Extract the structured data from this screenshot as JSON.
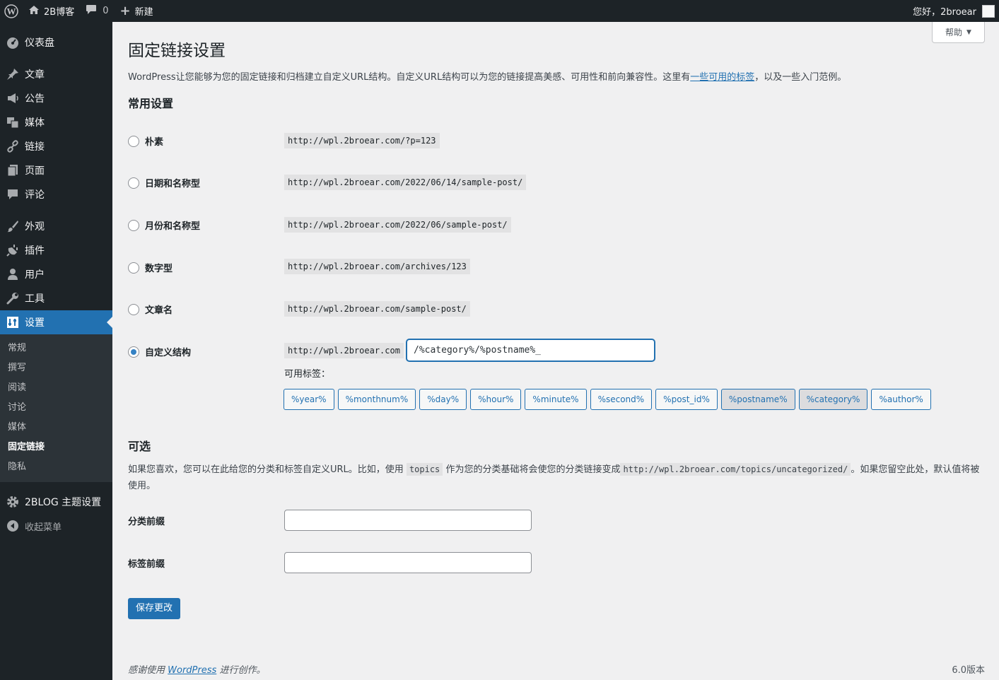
{
  "admin_bar": {
    "site_name": "2B博客",
    "comments_count": "0",
    "new_label": "新建",
    "greeting": "您好，2broear"
  },
  "sidebar": {
    "items": [
      {
        "label": "仪表盘",
        "icon": "dashboard-icon"
      },
      {
        "label": "文章",
        "icon": "pin-icon"
      },
      {
        "label": "公告",
        "icon": "megaphone-icon"
      },
      {
        "label": "媒体",
        "icon": "media-icon"
      },
      {
        "label": "链接",
        "icon": "link-icon"
      },
      {
        "label": "页面",
        "icon": "page-icon"
      },
      {
        "label": "评论",
        "icon": "comment-icon"
      },
      {
        "label": "外观",
        "icon": "brush-icon"
      },
      {
        "label": "插件",
        "icon": "plugin-icon"
      },
      {
        "label": "用户",
        "icon": "user-icon"
      },
      {
        "label": "工具",
        "icon": "wrench-icon"
      },
      {
        "label": "设置",
        "icon": "settings-icon"
      }
    ],
    "submenu": [
      "常规",
      "撰写",
      "阅读",
      "讨论",
      "媒体",
      "固定链接",
      "隐私"
    ],
    "theme_settings": "2BLOG 主题设置",
    "collapse": "收起菜单"
  },
  "help_tab": "帮助",
  "page": {
    "title": "固定链接设置",
    "intro_before": "WordPress让您能够为您的固定链接和归档建立自定义URL结构。自定义URL结构可以为您的链接提高美感、可用性和前向兼容性。这里有",
    "intro_link": "一些可用的标签",
    "intro_after": "，以及一些入门范例。"
  },
  "common_settings": {
    "heading": "常用设置",
    "options": [
      {
        "label": "朴素",
        "example": "http://wpl.2broear.com/?p=123",
        "checked": false
      },
      {
        "label": "日期和名称型",
        "example": "http://wpl.2broear.com/2022/06/14/sample-post/",
        "checked": false
      },
      {
        "label": "月份和名称型",
        "example": "http://wpl.2broear.com/2022/06/sample-post/",
        "checked": false
      },
      {
        "label": "数字型",
        "example": "http://wpl.2broear.com/archives/123",
        "checked": false
      },
      {
        "label": "文章名",
        "example": "http://wpl.2broear.com/sample-post/",
        "checked": false
      },
      {
        "label": "自定义结构",
        "example": "http://wpl.2broear.com",
        "checked": true
      }
    ],
    "custom_value": "/%category%/%postname%_",
    "available_tags_label": "可用标签：",
    "tags": [
      {
        "label": "%year%",
        "pressed": false
      },
      {
        "label": "%monthnum%",
        "pressed": false
      },
      {
        "label": "%day%",
        "pressed": false
      },
      {
        "label": "%hour%",
        "pressed": false
      },
      {
        "label": "%minute%",
        "pressed": false
      },
      {
        "label": "%second%",
        "pressed": false
      },
      {
        "label": "%post_id%",
        "pressed": false
      },
      {
        "label": "%postname%",
        "pressed": true
      },
      {
        "label": "%category%",
        "pressed": true
      },
      {
        "label": "%author%",
        "pressed": false
      }
    ]
  },
  "optional": {
    "heading": "可选",
    "desc_1": "如果您喜欢，您可以在此给您的分类和标签自定义URL。比如，使用",
    "code_1": "topics",
    "desc_2": "作为您的分类基础将会使您的分类链接变成",
    "code_2": "http://wpl.2broear.com/topics/uncategorized/",
    "desc_3": "。如果您留空此处，默认值将被使用。",
    "category_base_label": "分类前缀",
    "category_base_value": "",
    "tag_base_label": "标签前缀",
    "tag_base_value": ""
  },
  "save_button": "保存更改",
  "footer": {
    "before": "感谢使用",
    "link": "WordPress",
    "after": "进行创作。",
    "version": "6.0版本"
  }
}
